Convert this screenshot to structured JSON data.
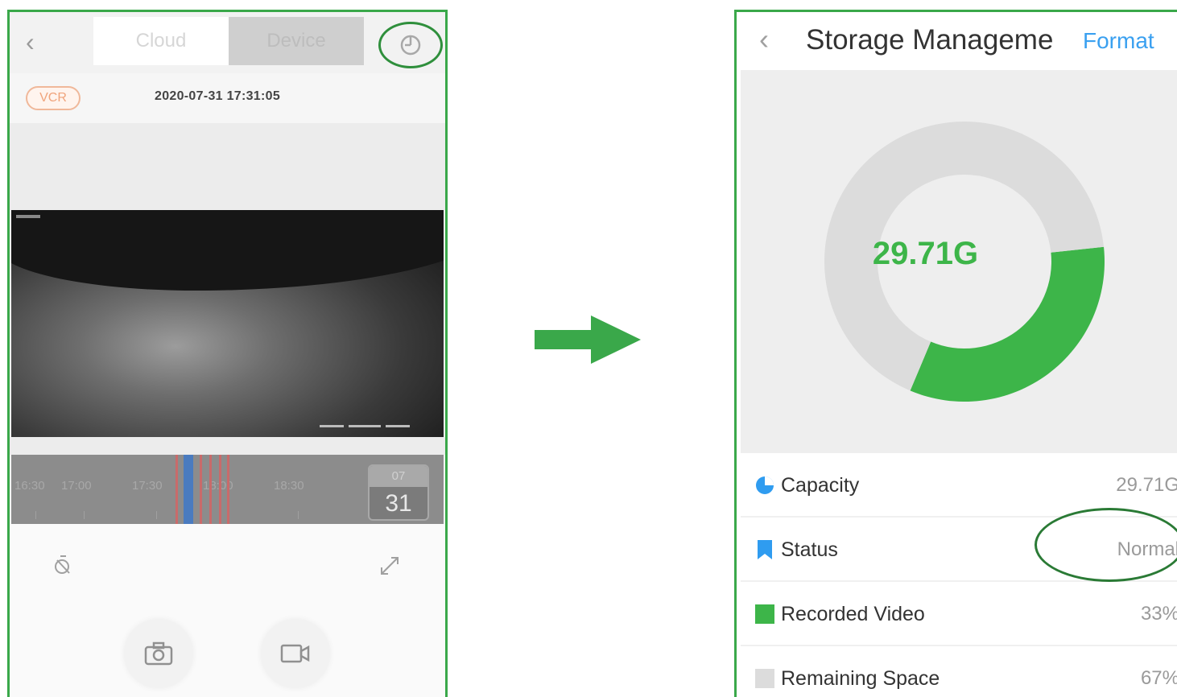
{
  "left_screen": {
    "tabs": [
      {
        "label": "Cloud",
        "active": true
      },
      {
        "label": "Device",
        "active": false
      }
    ],
    "vcr_badge": "VCR",
    "timestamp": "2020-07-31 17:31:05",
    "timeline_labels": [
      "16:30",
      "17:00",
      "17:30",
      "18:00",
      "18:30"
    ],
    "date_month": "07",
    "date_day": "31",
    "icons": [
      "back-icon",
      "history-icon",
      "mute-icon",
      "expand-icon",
      "camera-icon",
      "video-record-icon"
    ]
  },
  "right_screen": {
    "title": "Storage Manageme",
    "format_label": "Format",
    "center_value": "29.71G",
    "chart_data": {
      "type": "pie",
      "categories": [
        "Recorded Video",
        "Remaining Space"
      ],
      "values": [
        33,
        67
      ],
      "colors": [
        "#3db549",
        "#dcdcdc"
      ]
    },
    "rows": [
      {
        "label": "Capacity",
        "value": "29.71G",
        "icon": "pie-icon",
        "icon_color": "#2f9cf0"
      },
      {
        "label": "Status",
        "value": "Normal",
        "icon": "bookmark-icon",
        "icon_color": "#2f9cf0"
      },
      {
        "label": "Recorded Video",
        "value": "33%",
        "icon": "green-square-icon",
        "icon_color": "#3db549"
      },
      {
        "label": "Remaining Space",
        "value": "67%",
        "icon": "gray-square-icon",
        "icon_color": "#dcdcdc"
      }
    ]
  },
  "colors": {
    "frame": "#3aa84a",
    "accent_green": "#3db549",
    "accent_blue": "#3aa0f0"
  }
}
